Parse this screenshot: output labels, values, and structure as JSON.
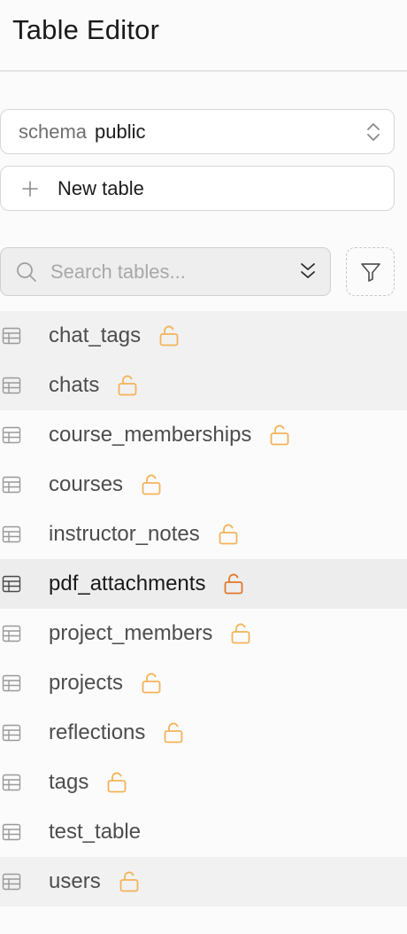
{
  "header": {
    "title": "Table Editor"
  },
  "schema": {
    "label": "schema",
    "value": "public"
  },
  "new_table": {
    "label": "New table"
  },
  "search": {
    "placeholder": "Search tables..."
  },
  "colors": {
    "lock_light": "#f2b35a",
    "lock_active": "#e0782b",
    "active_row": "#ededed"
  },
  "tables": [
    {
      "name": "chat_tags",
      "lock": true,
      "highlight": true,
      "active": false
    },
    {
      "name": "chats",
      "lock": true,
      "highlight": true,
      "active": false
    },
    {
      "name": "course_memberships",
      "lock": true,
      "highlight": false,
      "active": false
    },
    {
      "name": "courses",
      "lock": true,
      "highlight": false,
      "active": false
    },
    {
      "name": "instructor_notes",
      "lock": true,
      "highlight": false,
      "active": false
    },
    {
      "name": "pdf_attachments",
      "lock": true,
      "highlight": false,
      "active": true
    },
    {
      "name": "project_members",
      "lock": true,
      "highlight": false,
      "active": false
    },
    {
      "name": "projects",
      "lock": true,
      "highlight": false,
      "active": false
    },
    {
      "name": "reflections",
      "lock": true,
      "highlight": false,
      "active": false
    },
    {
      "name": "tags",
      "lock": true,
      "highlight": false,
      "active": false
    },
    {
      "name": "test_table",
      "lock": false,
      "highlight": false,
      "active": false
    },
    {
      "name": "users",
      "lock": true,
      "highlight": true,
      "active": false
    }
  ]
}
